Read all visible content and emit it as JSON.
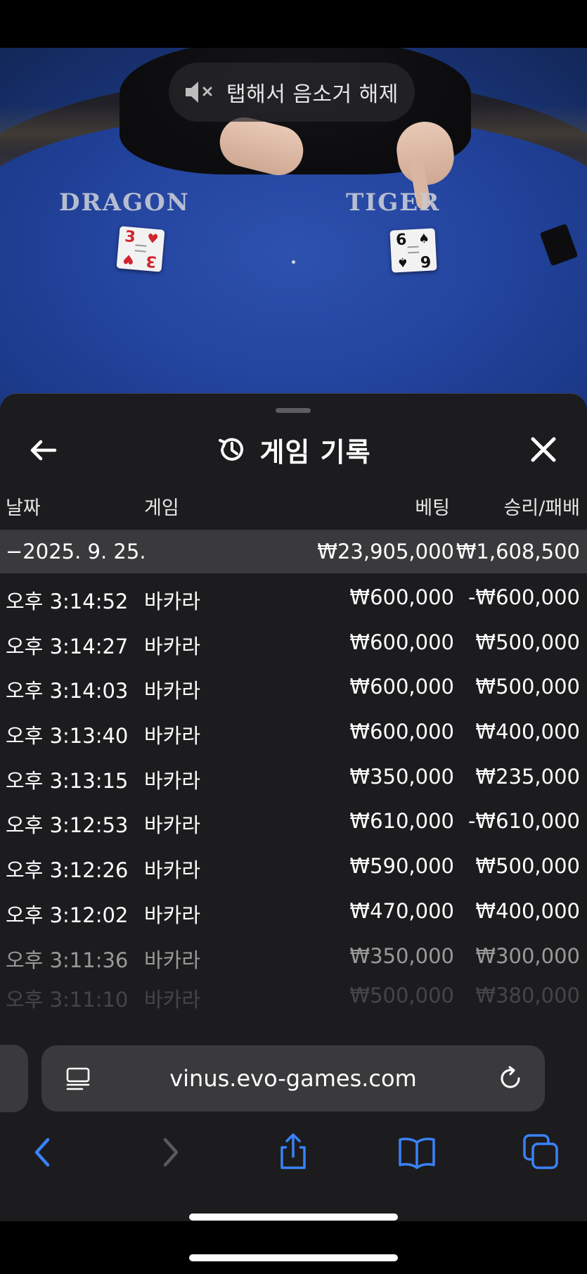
{
  "video": {
    "mute_hint": "탭해서 음소거 해제",
    "table_left_label": "DRAGON",
    "table_right_label": "TIGER",
    "dragon_card": {
      "rank": "3",
      "suit": "♥"
    },
    "tiger_card": {
      "rank": "6",
      "suit": "♠"
    }
  },
  "sheet": {
    "title": "게임 기록",
    "columns": {
      "date": "날짜",
      "game": "게임",
      "bet": "베팅",
      "win_loss": "승리/패배"
    },
    "date_summary": {
      "date": "−2025. 9. 25.",
      "bet_total": "₩23,905,000",
      "win_total": "₩1,608,500"
    },
    "rows": [
      {
        "time": "오후 3:14:52",
        "game": "바카라",
        "bet": "₩600,000",
        "result": "-₩600,000"
      },
      {
        "time": "오후 3:14:27",
        "game": "바카라",
        "bet": "₩600,000",
        "result": "₩500,000"
      },
      {
        "time": "오후 3:14:03",
        "game": "바카라",
        "bet": "₩600,000",
        "result": "₩500,000"
      },
      {
        "time": "오후 3:13:40",
        "game": "바카라",
        "bet": "₩600,000",
        "result": "₩400,000"
      },
      {
        "time": "오후 3:13:15",
        "game": "바카라",
        "bet": "₩350,000",
        "result": "₩235,000"
      },
      {
        "time": "오후 3:12:53",
        "game": "바카라",
        "bet": "₩610,000",
        "result": "-₩610,000"
      },
      {
        "time": "오후 3:12:26",
        "game": "바카라",
        "bet": "₩590,000",
        "result": "₩500,000"
      },
      {
        "time": "오후 3:12:02",
        "game": "바카라",
        "bet": "₩470,000",
        "result": "₩400,000"
      },
      {
        "time": "오후 3:11:36",
        "game": "바카라",
        "bet": "₩350,000",
        "result": "₩300,000"
      },
      {
        "time": "오후 3:11:10",
        "game": "바카라",
        "bet": "₩500,000",
        "result": "₩380,000"
      }
    ]
  },
  "browser": {
    "url": "vinus.evo-games.com",
    "icons": [
      "reader-icon",
      "reload-icon",
      "back-icon",
      "forward-icon",
      "share-icon",
      "bookmarks-icon",
      "tabs-icon"
    ]
  }
}
